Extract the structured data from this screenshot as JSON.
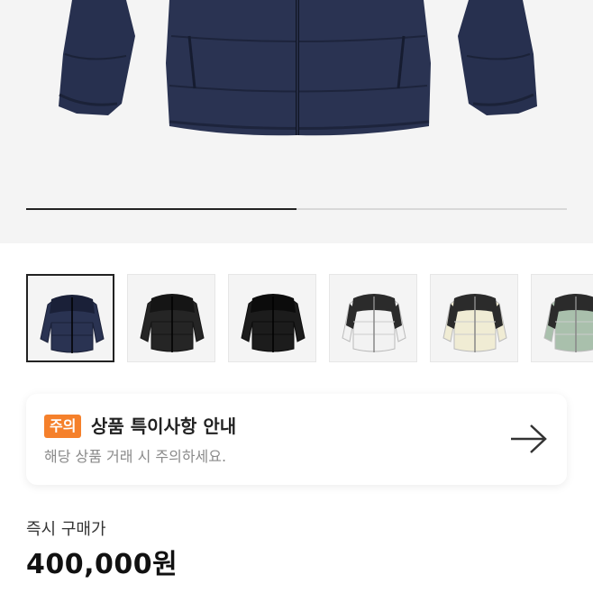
{
  "gallery": {
    "progress_fraction": 0.5,
    "thumbnails": [
      {
        "name": "navy",
        "color": "#2a3352",
        "accent": "#1a2038",
        "selected": true
      },
      {
        "name": "black",
        "color": "#252525",
        "accent": "#151515",
        "selected": false
      },
      {
        "name": "black-shiny",
        "color": "#1c1c1c",
        "accent": "#0c0c0c",
        "selected": false
      },
      {
        "name": "white",
        "color": "#f2f2f2",
        "accent": "#2b2b2b",
        "selected": false
      },
      {
        "name": "cream",
        "color": "#f0ecd4",
        "accent": "#2b2b2b",
        "selected": false
      },
      {
        "name": "sage",
        "color": "#a9c0ac",
        "accent": "#2b2b2b",
        "selected": false
      }
    ]
  },
  "notice": {
    "badge": "주의",
    "title": "상품 특이사항 안내",
    "subtitle": "해당 상품 거래 시 주의하세요."
  },
  "price": {
    "label": "즉시 구매가",
    "value": "400,000원"
  }
}
